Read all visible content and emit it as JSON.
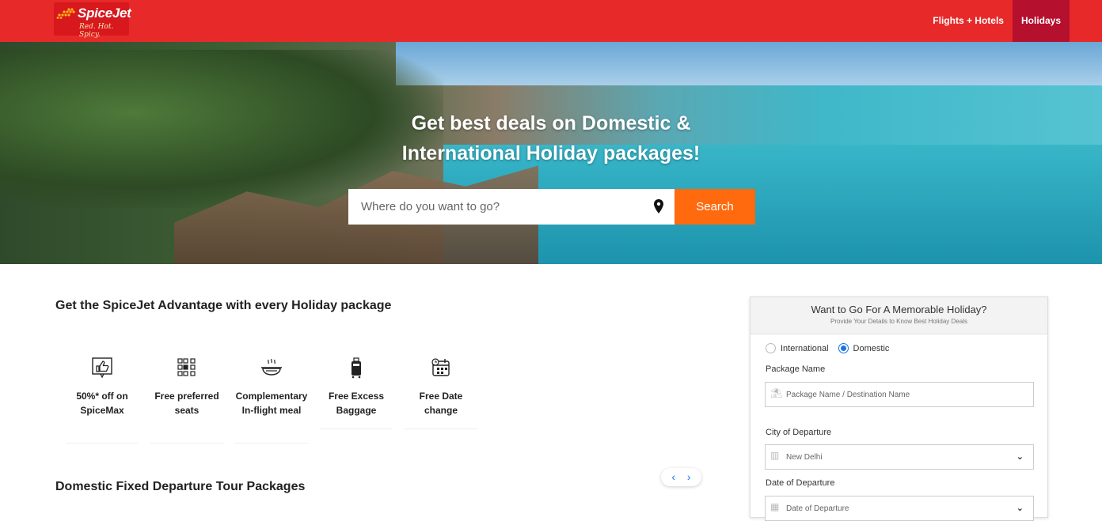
{
  "header": {
    "logo": {
      "brand": "SpiceJet",
      "tagline": "Red. Hot. Spicy."
    },
    "nav": [
      {
        "label": "Flights + Hotels",
        "active": false
      },
      {
        "label": "Holidays",
        "active": true
      }
    ],
    "colors": {
      "header": "#e8292a",
      "active_tab": "#b5102e"
    }
  },
  "hero": {
    "title_line1": "Get best deals on Domestic &",
    "title_line2": "International Holiday packages!",
    "search_placeholder": "Where do you want to go?",
    "search_button": "Search",
    "icons": {
      "location": "map-pin-icon"
    }
  },
  "advantages": {
    "title": "Get the SpiceJet Advantage with every Holiday package",
    "items": [
      {
        "icon": "thumbs-up-icon",
        "line1": "50%* off on",
        "line2": "SpiceMax"
      },
      {
        "icon": "seat-grid-icon",
        "line1": "Free preferred",
        "line2": "seats"
      },
      {
        "icon": "meal-icon",
        "line1": "Complementary",
        "line2": "In-flight meal"
      },
      {
        "icon": "luggage-icon",
        "line1": "Free Excess",
        "line2": "Baggage"
      },
      {
        "icon": "calendar-icon",
        "line1": "Free Date",
        "line2": "change"
      }
    ]
  },
  "domestic": {
    "title": "Domestic Fixed Departure Tour Packages",
    "carousel_prev": "‹",
    "carousel_next": "›"
  },
  "form": {
    "title": "Want to Go For A Memorable Holiday?",
    "subtitle": "Provide Your Details to Know Best Holiday Deals",
    "options": [
      "International",
      "Domestic"
    ],
    "selected": "Domestic",
    "package_label": "Package Name",
    "package_placeholder": "Package Name / Destination Name",
    "city_label": "City of Departure",
    "city_value": "New Delhi",
    "date_label": "Date of Departure",
    "date_placeholder": "Date of Departure"
  }
}
